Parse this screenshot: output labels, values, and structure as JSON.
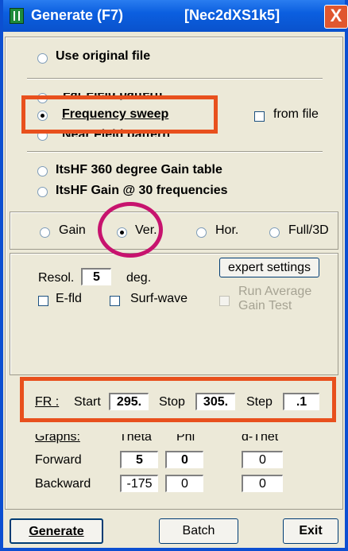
{
  "window": {
    "title": "Generate (F7)",
    "subtitle": "[Nec2dXS1k5]",
    "close_symbol": "X"
  },
  "source": {
    "use_original": "Use original file",
    "far_field": "Far Field pattern",
    "frequency_sweep": "Frequency sweep",
    "from_file": "from file",
    "near_field": "Near Field pattern",
    "itshf_360": "ItsHF 360 degree Gain table",
    "itshf_30": "ItsHF Gain @ 30 frequencies"
  },
  "pattern_type": {
    "gain": "Gain",
    "ver": "Ver.",
    "hor": "Hor.",
    "full3d": "Full/3D",
    "selected": "Ver."
  },
  "settings": {
    "resol_label": "Resol.",
    "resol_value": "5",
    "deg_label": "deg.",
    "expert_button": "expert settings",
    "efld": "E-fld",
    "surf_wave": "Surf-wave",
    "run_average_line1": "Run Average",
    "run_average_line2": "Gain Test"
  },
  "fr": {
    "label": "FR :",
    "start_label": "Start",
    "start_value": "295.",
    "stop_label": "Stop",
    "stop_value": "305.",
    "step_label": "Step",
    "step_value": ".1"
  },
  "graphs": {
    "label": "Graphs:",
    "theta": "Theta",
    "phi": "Phi",
    "dthet": "d-Thet",
    "forward": "Forward",
    "backward": "Backward",
    "fwd_theta": "5",
    "fwd_phi": "0",
    "fwd_dthet": "0",
    "bwd_theta": "-175",
    "bwd_phi": "0",
    "bwd_dthet": "0"
  },
  "buttons": {
    "generate": "Generate",
    "batch": "Batch",
    "exit": "Exit"
  },
  "colors": {
    "titlebar": "#0b5fe0",
    "dialog_bg": "#ece9d8",
    "highlight_box": "#e8501d",
    "highlight_circle": "#c7136e"
  }
}
